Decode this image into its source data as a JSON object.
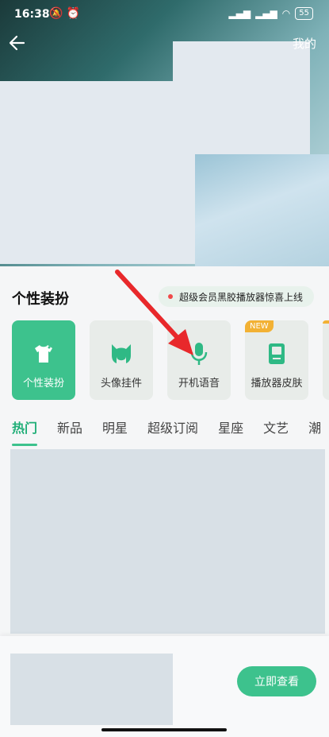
{
  "status": {
    "time": "16:38",
    "battery": "55"
  },
  "header": {
    "mine_label": "我的"
  },
  "section": {
    "title": "个性装扮"
  },
  "promo": {
    "text": "超级会员黑胶播放器惊喜上线"
  },
  "categories": [
    {
      "label": "个性装扮",
      "icon": "tshirt-icon"
    },
    {
      "label": "头像挂件",
      "icon": "cat-ears-icon"
    },
    {
      "label": "开机语音",
      "icon": "microphone-icon"
    },
    {
      "label": "播放器皮肤",
      "icon": "player-icon",
      "badge": "NEW"
    }
  ],
  "tabs": [
    "热门",
    "新品",
    "明星",
    "超级订阅",
    "星座",
    "文艺",
    "潮"
  ],
  "bottom": {
    "button_label": "立即查看"
  },
  "colors": {
    "accent": "#3dc28d",
    "arrow": "#e8282b"
  }
}
